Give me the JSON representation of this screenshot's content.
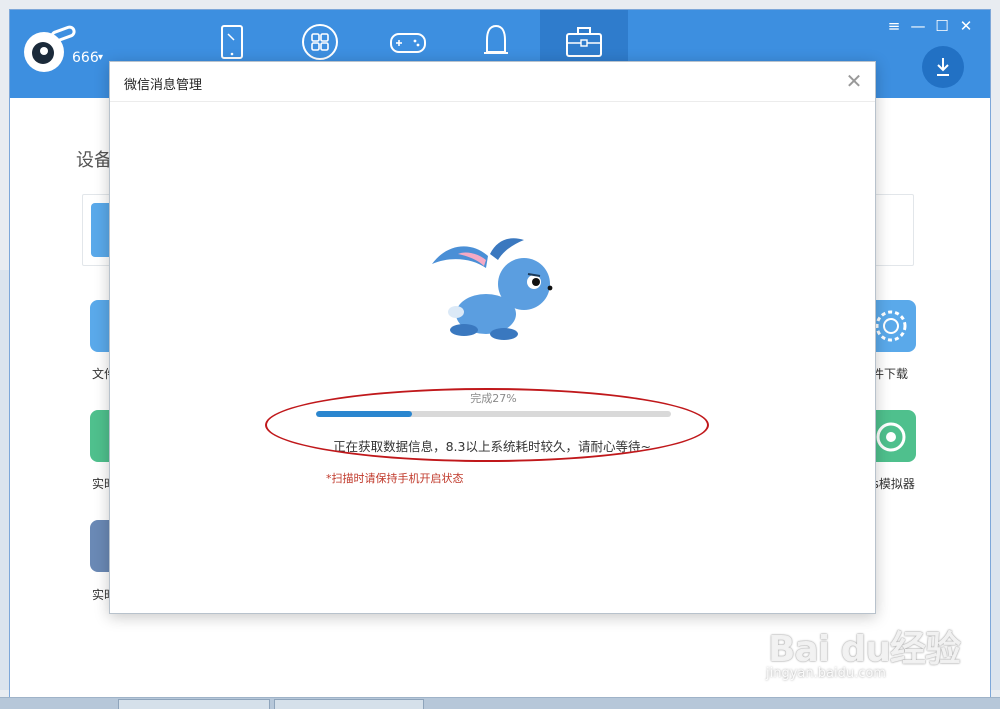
{
  "app": {
    "user_name": "666",
    "device_section_title": "设备",
    "tools_left": [
      "文件",
      "实时",
      "实时"
    ],
    "tools_right": [
      "件下载",
      "ols模拟器"
    ]
  },
  "modal": {
    "title": "微信消息管理",
    "close_glyph": "✕",
    "progress_percent": 27,
    "progress_label": "完成27%",
    "status_message": "正在获取数据信息，8.3以上系统耗时较久，请耐心等待~",
    "warning_message": "*扫描时请保持手机开启状态"
  },
  "watermark": {
    "brand": "Bai du经验",
    "url": "jingyan.baidu.com"
  },
  "colors": {
    "accent": "#3d8fe0",
    "progress": "#2a86cf",
    "warning": "#c0392b",
    "annotation": "#c0181b"
  }
}
